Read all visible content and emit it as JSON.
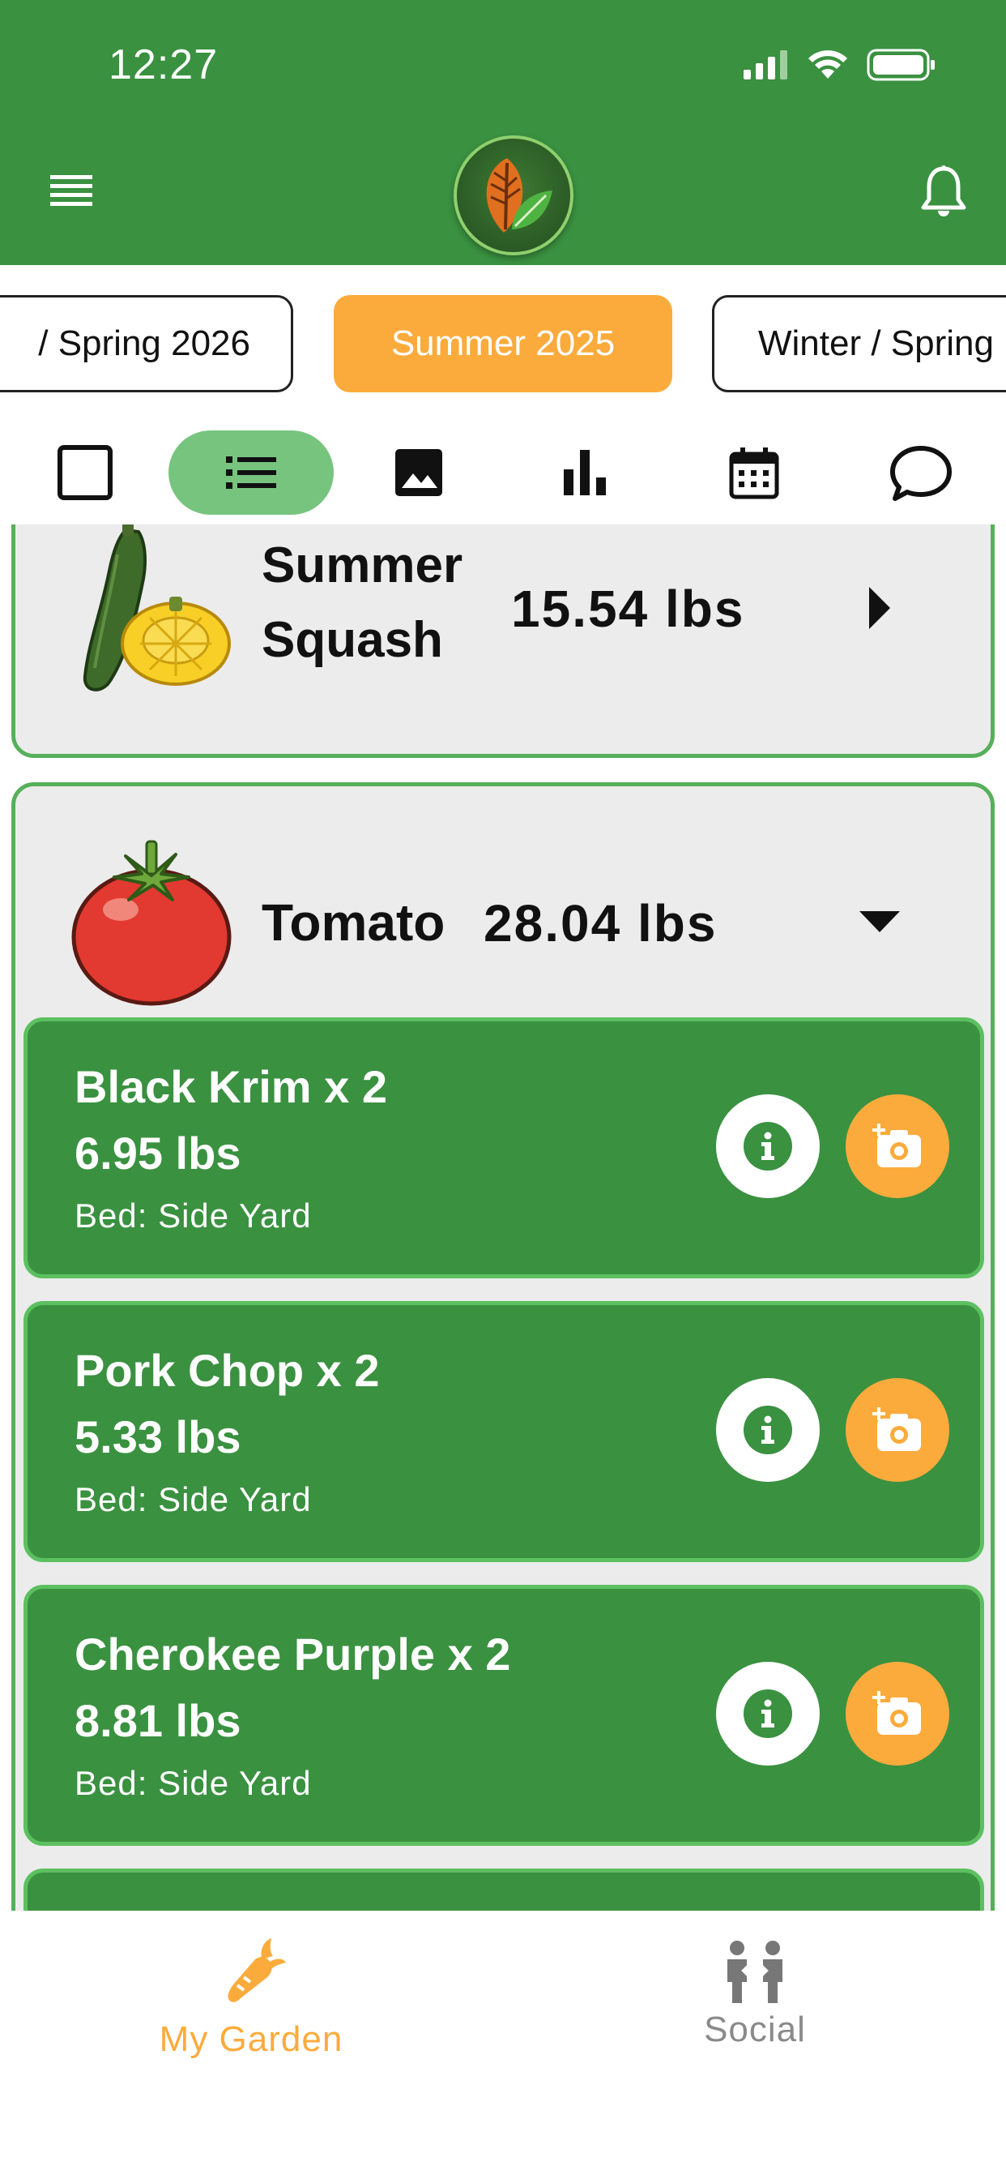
{
  "status_bar": {
    "time": "12:27"
  },
  "header": {
    "menu_icon": "hamburger-menu-icon",
    "logo_icon": "leaf-logo",
    "bell_icon": "bell-icon"
  },
  "seasons": {
    "prev_label": "/ Spring 2026",
    "active_label": "Summer 2025",
    "next_label": "Winter / Spring"
  },
  "view_toolbar": {
    "items": [
      "grid-view-icon",
      "list-view-icon",
      "image-view-icon",
      "chart-view-icon",
      "calendar-view-icon",
      "chat-view-icon"
    ],
    "active": "list-view-icon"
  },
  "crops": [
    {
      "name_line1": "Summer",
      "name_line2": "Squash",
      "weight": "15.54  lbs",
      "expanded": false
    },
    {
      "name": "Tomato",
      "weight": "28.04  lbs",
      "expanded": true
    }
  ],
  "varieties": [
    {
      "name": "Black Krim x 2",
      "weight": "6.95 lbs",
      "bed": "Bed: Side Yard"
    },
    {
      "name": "Pork Chop x 2",
      "weight": "5.33 lbs",
      "bed": "Bed: Side Yard"
    },
    {
      "name": "Cherokee Purple x 2",
      "weight": "8.81 lbs",
      "bed": "Bed: Side Yard"
    }
  ],
  "bottom_nav": {
    "garden_label": "My Garden",
    "social_label": "Social"
  },
  "colors": {
    "primary_green": "#3a9140",
    "accent_orange": "#fbab3c",
    "card_gray": "#ececec",
    "card_border": "#56b05a"
  }
}
